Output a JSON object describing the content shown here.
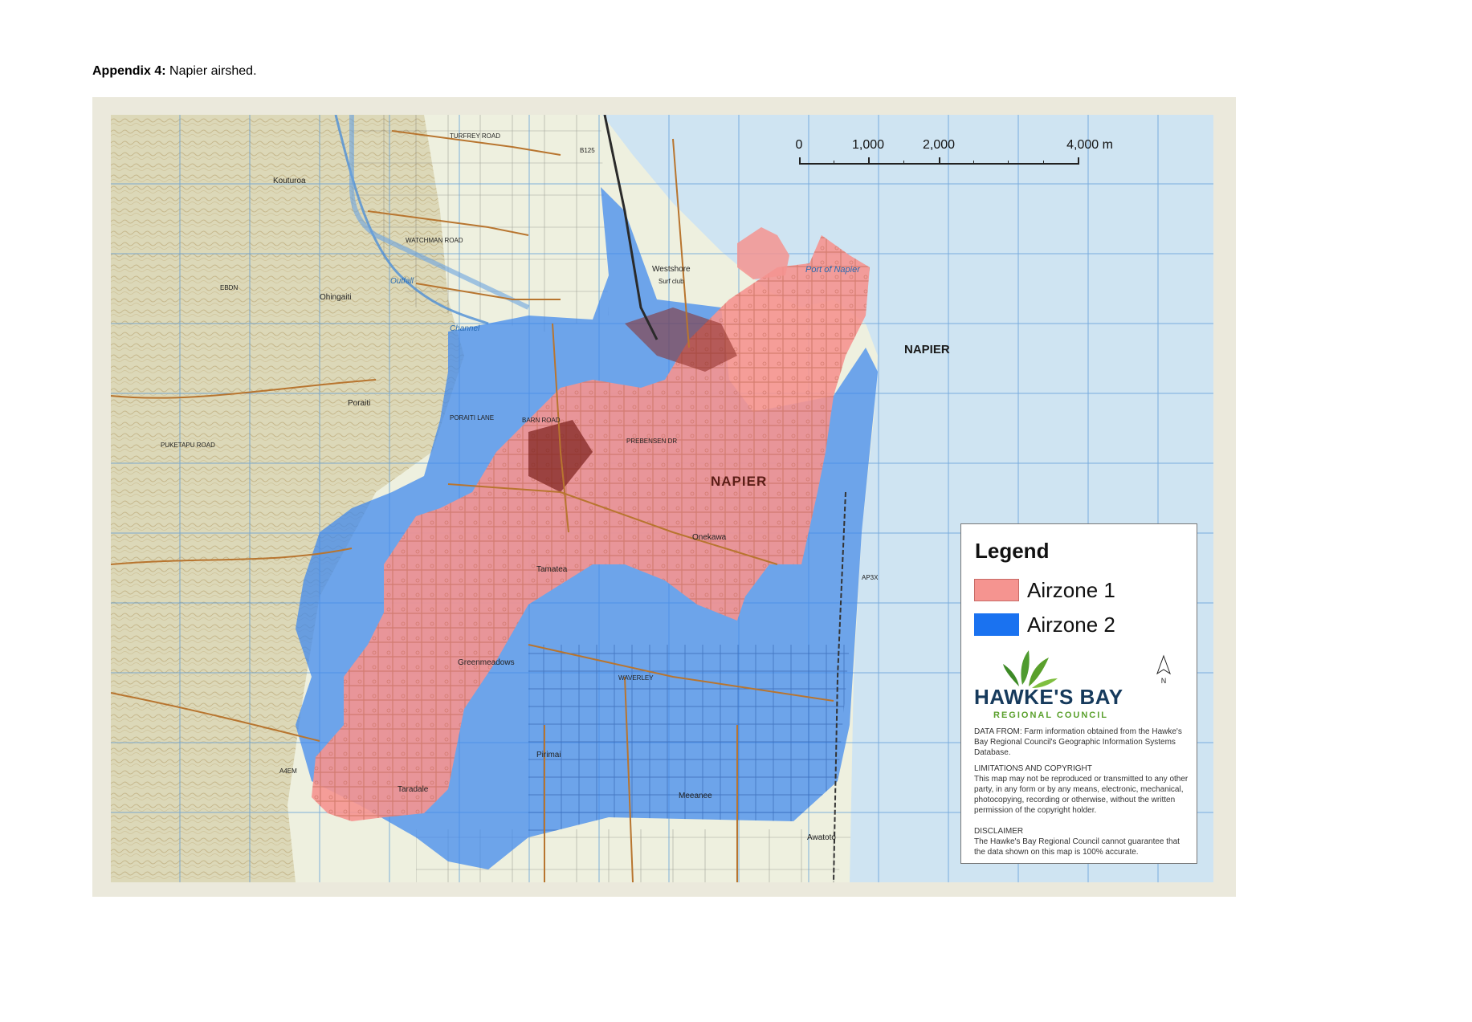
{
  "caption": {
    "label": "Appendix 4:",
    "text": " Napier airshed."
  },
  "scale": {
    "labels": [
      "0",
      "1,000",
      "2,000",
      "4,000 m"
    ]
  },
  "places": {
    "napier_main": "NAPIER",
    "napier_north": "NAPIER",
    "port": "Port of Napier",
    "westshore": "Westshore",
    "surf_club": "Surf club",
    "kouturoa": "Kouturoa",
    "ohingaiti": "Ohingaiti",
    "poraiti": "Poraiti",
    "taradale": "Taradale",
    "greenmeadows": "Greenmeadows",
    "tamatea": "Tamatea",
    "onekawa": "Onekawa",
    "pirimai": "Pirimai",
    "meeanee": "Meeanee",
    "awatoto": "Awatoto",
    "turfrey_road": "TURFREY ROAD",
    "watchman_road": "WATCHMAN ROAD",
    "prebensen": "PREBENSEN DR",
    "poraiti_lane": "PORAITI LANE",
    "barn_road": "BARN ROAD",
    "puketapu_road": "PUKETAPU ROAD",
    "waverley": "WAVERLEY",
    "ap3x": "AP3X",
    "b125": "B125",
    "ebdn": "EBDN",
    "a4em": "A4EM",
    "channel": "Channel",
    "outfall": "Outfall"
  },
  "legend": {
    "title": "Legend",
    "items": [
      {
        "label": "Airzone 1",
        "color": "#f59490"
      },
      {
        "label": "Airzone 2",
        "color": "#1a72f0"
      }
    ],
    "north": "N",
    "org_name": "HAWKE'S BAY",
    "org_sub": "REGIONAL COUNCIL",
    "data_from": "DATA FROM: Farm information  obtained from the Hawke's Bay Regional Council's Geographic Information Systems Database.",
    "limits_title": "LIMITATIONS AND COPYRIGHT",
    "limits_text": "This map may not be reproduced or transmitted to any other party, in any form or by any means, electronic, mechanical, photocopying, recording or otherwise, without the written permission of the copyright holder.",
    "disclaimer_title": "DISCLAIMER",
    "disclaimer_text": "The Hawke's Bay Regional Council cannot guarantee that the data shown on this map is 100% accurate."
  },
  "colors": {
    "sea": "#cfe4f2",
    "land": "#eef0df",
    "hills": "#d9d6b4",
    "airzone1": "#f59490",
    "airzone2": "#3c86ee",
    "road": "#b8752f",
    "grid": "#5b9ad6"
  }
}
